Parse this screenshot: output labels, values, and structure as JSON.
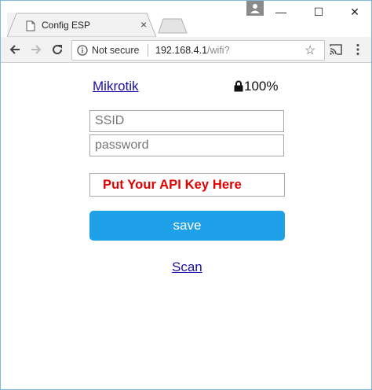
{
  "browser": {
    "tab_title": "Config ESP",
    "tab_close": "×",
    "window_min": "—",
    "window_max": "☐",
    "window_close": "✕",
    "security_label": "Not secure",
    "url_host": "192.168.4.1",
    "url_path": "/wifi?",
    "star": "☆"
  },
  "page": {
    "network_name": "Mikrotik",
    "network_signal": "100%",
    "ssid_placeholder": "SSID",
    "password_placeholder": "password",
    "api_key_text": "Put Your API Key Here",
    "save_label": "save",
    "scan_label": "Scan"
  },
  "colors": {
    "save_button": "#1ea1e8",
    "api_key_text": "#e00000",
    "link": "#1a0dab"
  }
}
